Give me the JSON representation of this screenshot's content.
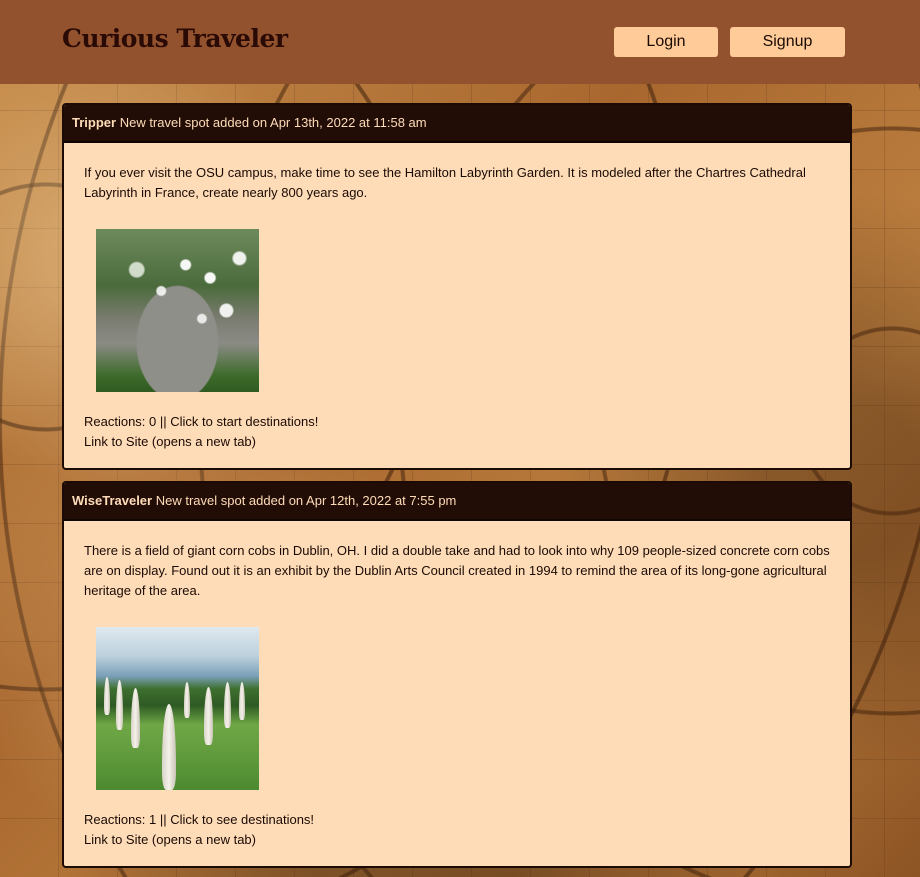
{
  "navbar": {
    "brand": "Curious Traveler",
    "login_label": "Login",
    "signup_label": "Signup"
  },
  "posts": [
    {
      "author": "Tripper",
      "meta": "New travel spot added on Apr 13th, 2022 at 11:58 am",
      "description": "If you ever visit the OSU campus, make time to see the Hamilton Labyrinth Garden. It is modeled after the Chartres Cathedral Labyrinth in France, create nearly 800 years ago.",
      "reactions": "Reactions: 0 || Click to start destinations!",
      "link": "Link to Site (opens a new tab)"
    },
    {
      "author": "WiseTraveler",
      "meta": "New travel spot added on Apr 12th, 2022 at 7:55 pm",
      "description": "There is a field of giant corn cobs in Dublin, OH. I did a double take and had to look into why 109 people-sized concrete corn cobs are on display. Found out it is an exhibit by the Dublin Arts Council created in 1994 to remind the area of its long-gone agricultural heritage of the area.",
      "reactions": "Reactions: 1 || Click to see destinations!",
      "link": "Link to Site (opens a new tab)"
    }
  ],
  "colors": {
    "navbar_bg": "#93522e",
    "button_bg": "#ffcc99",
    "card_bg": "#ffdcb8",
    "card_header_bg": "#220d06",
    "brand_text": "#2a0a04"
  }
}
